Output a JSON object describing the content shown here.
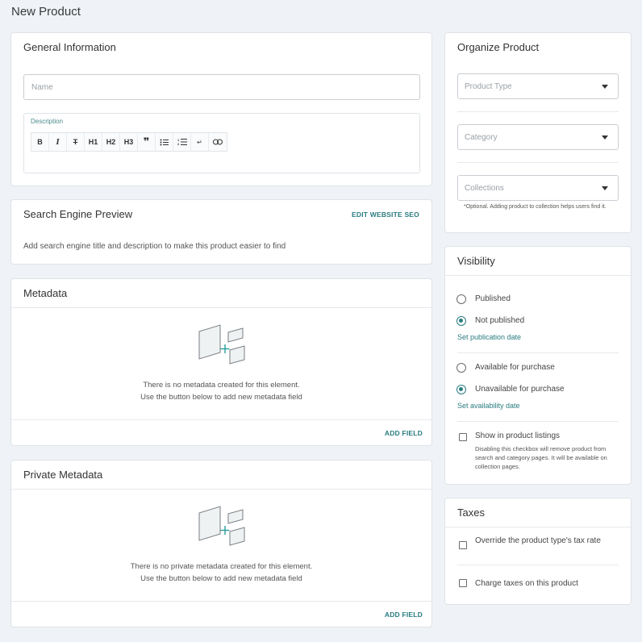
{
  "page": {
    "title": "New Product"
  },
  "general": {
    "title": "General Information",
    "name_placeholder": "Name",
    "description_label": "Description",
    "toolbar": [
      "B",
      "I",
      "S",
      "H1",
      "H2",
      "H3",
      "❞",
      "•",
      "1.",
      "↵",
      "⊝"
    ]
  },
  "seo": {
    "title": "Search Engine Preview",
    "action": "EDIT WEBSITE SEO",
    "text": "Add search engine title and description to make this product easier to find"
  },
  "metadata": {
    "title": "Metadata",
    "empty_line1": "There is no metadata created for this element.",
    "empty_line2": "Use the button below to add new metadata field",
    "action": "ADD FIELD"
  },
  "private_metadata": {
    "title": "Private Metadata",
    "empty_line1": "There is no private metadata created for this element.",
    "empty_line2": "Use the button below to add new metadata field",
    "action": "ADD FIELD"
  },
  "organize": {
    "title": "Organize Product",
    "product_type": "Product Type",
    "category": "Category",
    "collections": "Collections",
    "collections_hint": "*Optional. Adding product to collection helps users find it."
  },
  "visibility": {
    "title": "Visibility",
    "published": "Published",
    "not_published": "Not published",
    "set_publication": "Set publication date",
    "available": "Available for purchase",
    "unavailable": "Unavailable for purchase",
    "set_availability": "Set availability date",
    "show_listings": "Show in product listings",
    "show_listings_hint": "Disabling this checkbox will remove product from search and category pages. It will be available on collection pages."
  },
  "taxes": {
    "title": "Taxes",
    "override": "Override the product type's tax rate",
    "charge": "Charge taxes on this product"
  },
  "colors": {
    "accent": "#2a7c80",
    "background": "#eff3f7"
  }
}
